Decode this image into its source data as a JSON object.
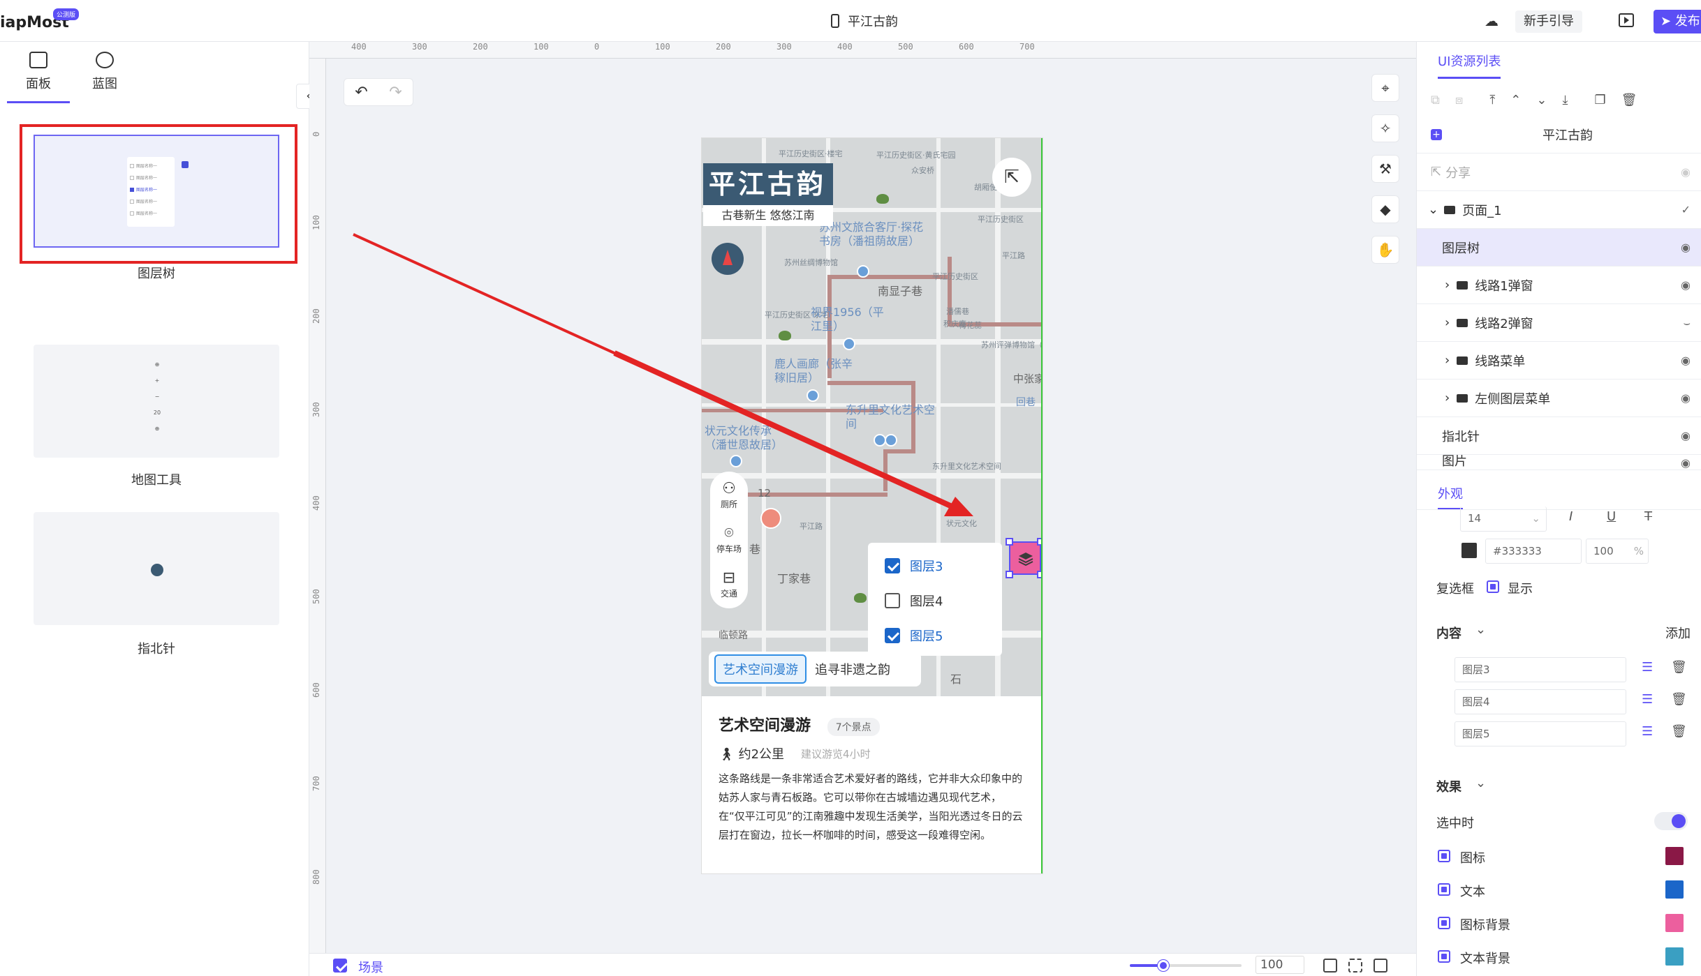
{
  "app": {
    "logo_text": "iapMost",
    "badge": "公测版",
    "doc_title": "平江古韵"
  },
  "header": {
    "guide_label": "新手引导",
    "publish_label": "发布"
  },
  "left_panel": {
    "tabs": [
      {
        "label": "面板",
        "icon": "panel-icon"
      },
      {
        "label": "蓝图",
        "icon": "blueprint-icon"
      }
    ],
    "thumbnails": [
      {
        "label": "图层树"
      },
      {
        "label": "地图工具"
      },
      {
        "label": "指北针"
      }
    ],
    "mini_layer_items": [
      "图层名称一",
      "图层名称一",
      "图层名称一",
      "图层名称一",
      "图层名称一"
    ],
    "mini_maptool_items": [
      "⊕",
      "+",
      "−",
      "20",
      "⊕"
    ]
  },
  "ruler": {
    "top_ticks": [
      "400",
      "300",
      "200",
      "100",
      "0",
      "100",
      "200",
      "300",
      "400",
      "500",
      "600",
      "700"
    ],
    "left_ticks": [
      "0",
      "100",
      "200",
      "300",
      "400",
      "500",
      "600",
      "700",
      "800"
    ]
  },
  "phone": {
    "title": "平江古韵",
    "subtitle": "古巷新生  悠悠江南",
    "map_labels": [
      "平江历史街区·楼宅",
      "平江历史街区·黄氏宅园",
      "众安桥",
      "胡厢使巷",
      "平江历史街区",
      "平江路",
      "苏州丝绸博物馆",
      "南显子巷",
      "平江历史街区",
      "潘儒巷",
      "平江历史街区·东宅",
      "荷花蕊",
      "积庆庵",
      "苏州评弹博物馆（北馆）",
      "中张家巷",
      "回巷",
      "东升里文化艺术空间",
      "状元文化",
      "平江路",
      "12",
      "巷",
      "丁家巷",
      "临顿路",
      "石"
    ],
    "poi_labels": [
      "苏州文旅合客厅·探花书房（潘祖荫故居）",
      "视界1956（平江里）",
      "鹿人画廊（张辛稼旧居）",
      "东升里文化艺术空间",
      "状元文化传承（潘世恩故居）"
    ],
    "side_menu": [
      {
        "label": "厕所",
        "icon": "toilet-icon"
      },
      {
        "label": "停车场",
        "icon": "parking-icon"
      },
      {
        "label": "交通",
        "icon": "bus-icon"
      }
    ],
    "layers": [
      {
        "label": "图层3",
        "checked": true
      },
      {
        "label": "图层4",
        "checked": false
      },
      {
        "label": "图层5",
        "checked": true
      }
    ],
    "route_tabs": [
      "艺术空间漫游",
      "追寻非遗之韵"
    ],
    "card": {
      "title": "艺术空间漫游",
      "badge": "7个景点",
      "distance": "约2公里",
      "hint": "建议游览4小时",
      "desc": "这条路线是一条非常适合艺术爱好者的路线，它并非大众印象中的姑苏人家与青石板路。它可以带你在古城墙边遇见现代艺术，在“仅平江可见”的江南雅趣中发现生活美学，当阳光透过冬日的云层打在窗边，拉长一杯咖啡的时间，感受这一段难得空闲。"
    }
  },
  "bottom_bar": {
    "scene_label": "场景",
    "zoom_value": "100",
    "zoom_unit": "%",
    "zoom_level": 0.3
  },
  "right_panel": {
    "title": "UI资源列表",
    "root": "平江古韵",
    "share": "分享",
    "page": "页面_1",
    "tree": [
      {
        "label": "图层树",
        "selected": true,
        "folder": false,
        "expandable": false
      },
      {
        "label": "线路1弹窗",
        "selected": false,
        "folder": true,
        "expandable": true
      },
      {
        "label": "线路2弹窗",
        "selected": false,
        "folder": true,
        "expandable": true
      },
      {
        "label": "线路菜单",
        "selected": false,
        "folder": true,
        "expandable": true
      },
      {
        "label": "左侧图层菜单",
        "selected": false,
        "folder": true,
        "expandable": true
      },
      {
        "label": "指北针",
        "selected": false,
        "folder": false,
        "expandable": false
      },
      {
        "label": "图片",
        "selected": false,
        "folder": false,
        "expandable": false
      }
    ],
    "appearance": {
      "title": "外观",
      "font_size": "14",
      "color_hex": "#333333",
      "opacity": "100",
      "opacity_unit": "%",
      "checkbox_label": "复选框",
      "show_label": "显示",
      "content_label": "内容",
      "add_label": "添加",
      "content_items": [
        "图层3",
        "图层4",
        "图层5"
      ],
      "effect_label": "效果",
      "selected_label": "选中时",
      "colors": [
        {
          "label": "图标",
          "color": "#8a1846"
        },
        {
          "label": "文本",
          "color": "#1b66c9"
        },
        {
          "label": "图标背景",
          "color": "#ec5f9e"
        },
        {
          "label": "文本背景",
          "color": "#3a9fc2"
        }
      ]
    }
  }
}
